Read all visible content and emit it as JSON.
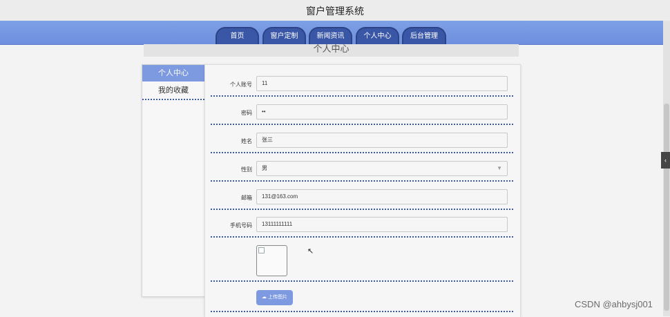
{
  "app": {
    "title": "窗户管理系统"
  },
  "nav": {
    "tabs": [
      {
        "label": "首页"
      },
      {
        "label": "窗户定制"
      },
      {
        "label": "新闻资讯"
      },
      {
        "label": "个人中心"
      },
      {
        "label": "后台管理"
      }
    ]
  },
  "page": {
    "heading": "个人中心"
  },
  "sidebar": {
    "items": [
      {
        "label": "个人中心",
        "active": true
      },
      {
        "label": "我的收藏",
        "active": false
      }
    ]
  },
  "form": {
    "fields": [
      {
        "label": "个人账号",
        "value": "11"
      },
      {
        "label": "密码",
        "value": "••"
      },
      {
        "label": "姓名",
        "value": "张三"
      },
      {
        "label": "性别",
        "value": "男"
      },
      {
        "label": "邮箱",
        "value": "131@163.com"
      },
      {
        "label": "手机号码",
        "value": "13111111111"
      }
    ],
    "upload_label": "上传图片"
  },
  "watermark": "CSDN @ahbysj001",
  "icons": {
    "collapse": "chevron-left-icon",
    "upload": "cloud-upload-icon",
    "select": "chevron-down-icon",
    "cursor": "mouse-pointer-icon"
  },
  "colors": {
    "nav_bar": "#7ea0e6",
    "nav_tab": "#3a57a7",
    "accent": "#7d9ae0",
    "separator": "#3d58a8"
  }
}
